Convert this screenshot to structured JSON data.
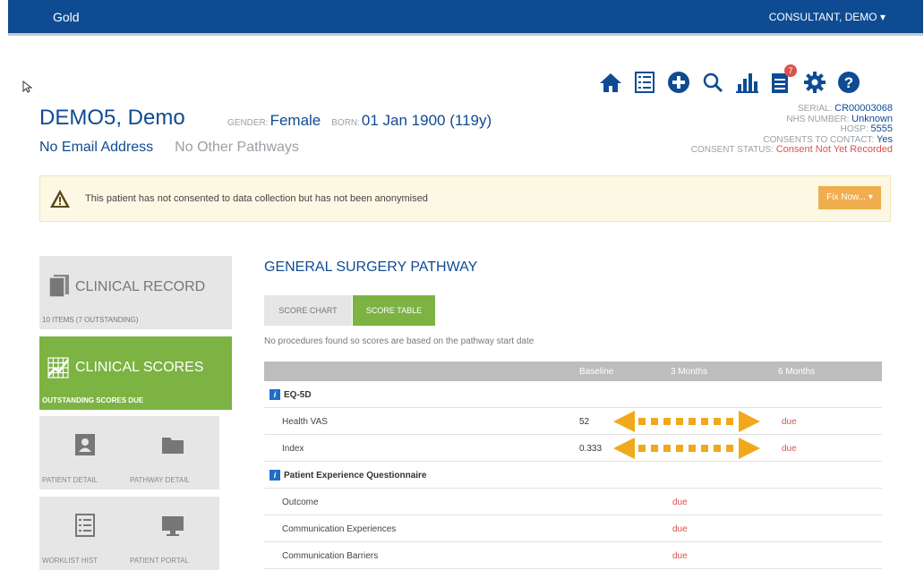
{
  "topbar": {
    "brand": "Gold",
    "user": "CONSULTANT, DEMO ▾"
  },
  "toolbar_icons": [
    "home-icon",
    "list-icon",
    "add-circle-icon",
    "search-icon",
    "bar-chart-icon",
    "notes-icon",
    "gear-icon",
    "help-icon"
  ],
  "notes_badge": "7",
  "patient": {
    "name": "DEMO5, Demo",
    "gender_label": "GENDER:",
    "gender": "Female",
    "born_label": "BORN:",
    "born": "01 Jan 1900 (119y)",
    "email": "No Email Address",
    "other": "No Other Pathways"
  },
  "info": {
    "serial_label": "SERIAL:",
    "serial": "CR00003068",
    "nhs_label": "NHS NUMBER:",
    "nhs": "Unknown",
    "hosp_label": "HOSP:",
    "hosp": "5555",
    "consent_contact_label": "CONSENTS TO CONTACT:",
    "consent_contact": "Yes",
    "consent_status_label": "CONSENT STATUS:",
    "consent_status": "Consent Not Yet Recorded"
  },
  "alert": {
    "message": "This patient has not consented to data collection but has not been anonymised",
    "button": "Fix Now... ▾"
  },
  "sidebar": {
    "clinical_record": {
      "title": "CLINICAL RECORD",
      "sub": "10 ITEMS (7 OUTSTANDING)"
    },
    "clinical_scores": {
      "title": "CLINICAL SCORES",
      "sub": "OUTSTANDING SCORES DUE"
    },
    "patient_detail": "PATIENT DETAIL",
    "pathway_detail": "PATHWAY DETAIL",
    "worklist_hist": "WORKLIST HIST",
    "patient_portal": "PATIENT PORTAL"
  },
  "main": {
    "title": "GENERAL SURGERY PATHWAY",
    "tab_chart": "SCORE CHART",
    "tab_table": "SCORE TABLE",
    "note": "No procedures found so scores are based on the pathway start date",
    "columns": [
      "Baseline",
      "3 Months",
      "6 Months"
    ],
    "group1": "EQ-5D",
    "health_vas": {
      "label": "Health VAS",
      "baseline": "52",
      "m6": "due"
    },
    "index": {
      "label": "Index",
      "baseline": "0.333",
      "m6": "due"
    },
    "group2": "Patient Experience Questionnaire",
    "outcome": {
      "label": "Outcome",
      "m3": "due"
    },
    "comm_exp": {
      "label": "Communication Experiences",
      "m3": "due"
    },
    "comm_bar": {
      "label": "Communication Barriers",
      "m3": "due"
    }
  },
  "colors": {
    "brand": "#0f4b93",
    "green": "#7cb342",
    "due": "#d9534f",
    "arrow": "#f0a91c"
  }
}
